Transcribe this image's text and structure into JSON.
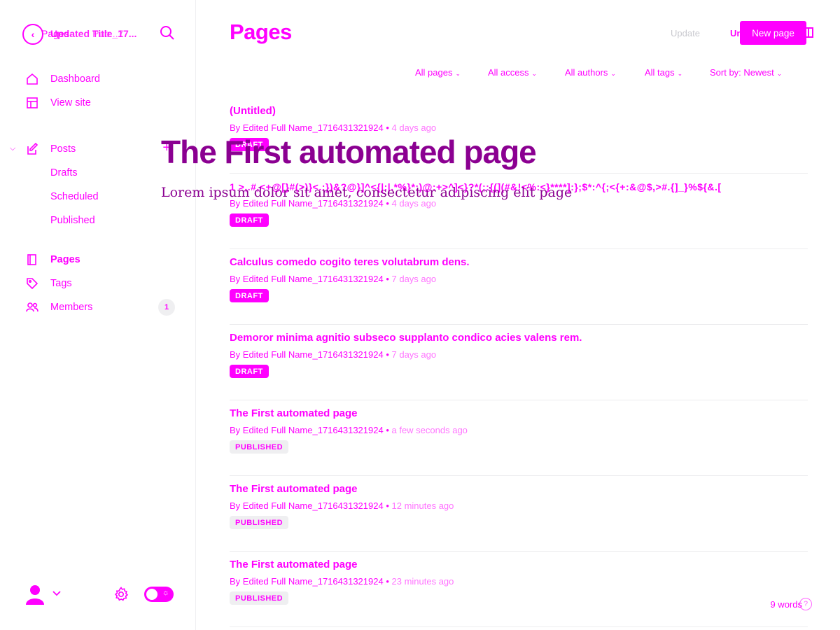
{
  "sidebar": {
    "breadcrumb": {
      "parent": "Pages",
      "title_primary": "Updated Title_17...",
      "title_secondary": "Pub...7"
    },
    "nav": [
      {
        "label": "Dashboard",
        "icon": "home-icon"
      },
      {
        "label": "View site",
        "icon": "layout-icon"
      }
    ],
    "posts": {
      "label": "Posts",
      "icon": "pencil-icon",
      "children": [
        "Drafts",
        "Scheduled",
        "Published"
      ]
    },
    "nav2": [
      {
        "label": "Pages",
        "icon": "page-icon",
        "active": true
      },
      {
        "label": "Tags",
        "icon": "tag-icon"
      },
      {
        "label": "Members",
        "icon": "members-icon",
        "count": "1"
      }
    ]
  },
  "header": {
    "title": "Pages",
    "update_label": "Update",
    "unpublish_label": "Unpub",
    "new_page_label": "New page"
  },
  "filters": [
    "All pages",
    "All access",
    "All authors",
    "All tags",
    "Sort by: Newest"
  ],
  "pages": [
    {
      "title": "(Untitled)",
      "author": "By Edited Full Name_1716431321924",
      "time": "4 days ago",
      "status": "DRAFT"
    },
    {
      "title": "",
      "author": "By Edited Full Name_1716431321924",
      "time": "4 days ago",
      "status": "DRAFT"
    },
    {
      "title": "Calculus comedo cogito teres volutabrum dens.",
      "author": "By Edited Full Name_1716431321924",
      "time": "7 days ago",
      "status": "DRAFT"
    },
    {
      "title": "Demoror minima agnitio subseco supplanto condico acies valens rem.",
      "author": "By Edited Full Name_1716431321924",
      "time": "7 days ago",
      "status": "DRAFT"
    },
    {
      "title": "The First automated page",
      "author": "By Edited Full Name_1716431321924",
      "time": "a few seconds ago",
      "status": "PUBLISHED"
    },
    {
      "title": "The First automated page",
      "author": "By Edited Full Name_1716431321924",
      "time": "12 minutes ago",
      "status": "PUBLISHED"
    },
    {
      "title": "The First automated page",
      "author": "By Edited Full Name_1716431321924",
      "time": "23 minutes ago",
      "status": "PUBLISHED",
      "words": "9 words"
    }
  ],
  "overlay": {
    "title": "The First automated page",
    "subtitle": "Lorem ipsum dolor sit amet, consectetur adipiscing elit page",
    "glitch_text": "1 >,.#,<+@[}#(>)}<.:})&?@}]^<{|:|.*%}*:)@:+>^]<}?*(;:{(](#&!<%:<}****]:};$*:^{;<{+:&@$,>#.{]_}%${&.["
  },
  "colors": {
    "accent": "#ff00ff",
    "overlay": "#8b0091",
    "pill_bg": "#efeff1"
  }
}
